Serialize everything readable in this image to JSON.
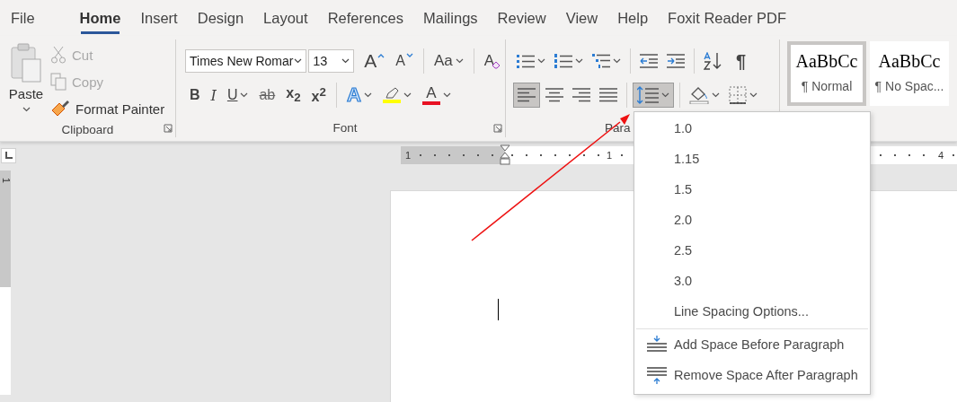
{
  "tabs": [
    {
      "label": "File",
      "selected": false
    },
    {
      "label": "Home",
      "selected": true
    },
    {
      "label": "Insert",
      "selected": false
    },
    {
      "label": "Design",
      "selected": false
    },
    {
      "label": "Layout",
      "selected": false
    },
    {
      "label": "References",
      "selected": false
    },
    {
      "label": "Mailings",
      "selected": false
    },
    {
      "label": "Review",
      "selected": false
    },
    {
      "label": "View",
      "selected": false
    },
    {
      "label": "Help",
      "selected": false
    },
    {
      "label": "Foxit Reader PDF",
      "selected": false
    }
  ],
  "clipboard": {
    "paste": "Paste",
    "label": "Clipboard",
    "items": [
      {
        "kind": "cut",
        "label": "Cut",
        "disabled": true
      },
      {
        "kind": "copy",
        "label": "Copy",
        "disabled": true
      },
      {
        "kind": "format-painter",
        "label": "Format Painter",
        "disabled": false
      }
    ]
  },
  "font": {
    "font_name": "Times New Romar",
    "font_size": "13",
    "label": "Font",
    "row1": [
      {
        "kind": "grow",
        "label": "A"
      },
      {
        "kind": "shrink",
        "label": "A"
      },
      {
        "kind": "change-case",
        "label": "Aa",
        "dropdown": true
      },
      {
        "kind": "clear-formatting",
        "label": "A"
      }
    ],
    "row2": [
      {
        "kind": "bold",
        "label": "B"
      },
      {
        "kind": "italic",
        "label": "I"
      },
      {
        "kind": "underline",
        "label": "U",
        "dropdown": true
      },
      {
        "kind": "strikethrough",
        "label": "ab"
      },
      {
        "kind": "subscript",
        "label": "x$_{2}$"
      },
      {
        "kind": "superscript",
        "label": "x$^{2}$"
      },
      {
        "kind": "text-effects",
        "label": "A",
        "dropdown": true
      },
      {
        "kind": "highlight",
        "dropdown": true
      },
      {
        "kind": "font-color",
        "label": "A",
        "dropdown": true
      }
    ]
  },
  "paragraph": {
    "label": "Para",
    "row1": [
      {
        "kind": "bullets",
        "dropdown": true
      },
      {
        "kind": "numbering",
        "dropdown": true
      },
      {
        "kind": "multilevel",
        "dropdown": true
      },
      {
        "kind": "decrease-indent"
      },
      {
        "kind": "increase-indent"
      },
      {
        "kind": "sort"
      },
      {
        "kind": "show-marks",
        "label": "¶"
      }
    ],
    "row2": [
      {
        "kind": "align-left",
        "selected": true
      },
      {
        "kind": "center",
        "selected": false
      },
      {
        "kind": "align-right",
        "selected": false
      },
      {
        "kind": "justify",
        "selected": false
      },
      {
        "kind": "line-spacing",
        "selected": true,
        "dropdown": true
      },
      {
        "kind": "shading",
        "selected": false,
        "dropdown": true
      },
      {
        "kind": "borders",
        "selected": false,
        "dropdown": true
      }
    ]
  },
  "styles": [
    {
      "preview": "AaBbCc",
      "name": "¶ Normal",
      "selected": true
    },
    {
      "preview": "AaBbCc",
      "name": "¶ No Spac...",
      "selected": false
    }
  ],
  "ruler": {
    "labels": [
      "1",
      "1",
      "4"
    ],
    "vertical_label": "1"
  },
  "line_spacing_menu": [
    {
      "kind": "value",
      "label": "1.0"
    },
    {
      "kind": "value",
      "label": "1.15"
    },
    {
      "kind": "value",
      "label": "1.5"
    },
    {
      "kind": "value",
      "label": "2.0"
    },
    {
      "kind": "value",
      "label": "2.5"
    },
    {
      "kind": "value",
      "label": "3.0"
    },
    {
      "kind": "option",
      "label": "Line Spacing Options..."
    },
    {
      "kind": "add-space-before",
      "label": "Add Space Before Paragraph"
    },
    {
      "kind": "remove-space-after",
      "label": "Remove Space After Paragraph"
    }
  ]
}
